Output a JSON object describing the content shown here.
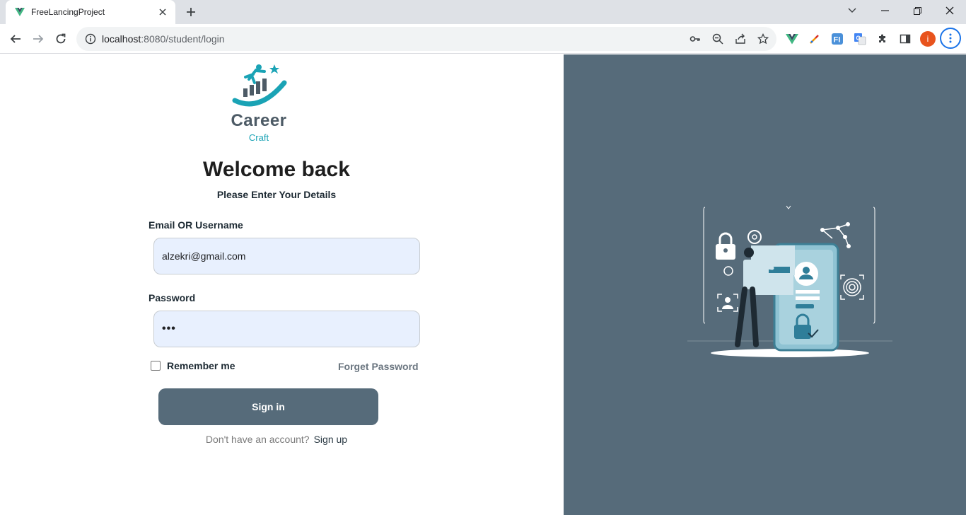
{
  "browser": {
    "tab_title": "FreeLancingProject",
    "url_host": "localhost",
    "url_path": ":8080/student/login",
    "profile_initial": "i"
  },
  "brand": {
    "name_line1": "Career",
    "name_line2": "Craft"
  },
  "login": {
    "title": "Welcome back",
    "subtitle": "Please Enter Your Details",
    "email_label": "Email OR Username",
    "email_value": "alzekri@gmail.com",
    "password_label": "Password",
    "password_value": "•••",
    "remember_label": "Remember me",
    "forget_label": "Forget Password",
    "signin_label": "Sign in",
    "no_account_text": "Don't have an account?",
    "signup_label": "Sign up"
  },
  "colors": {
    "accent": "#566b7a",
    "input_bg": "#e8f0fe",
    "logo_teal": "#1aa3b5"
  }
}
